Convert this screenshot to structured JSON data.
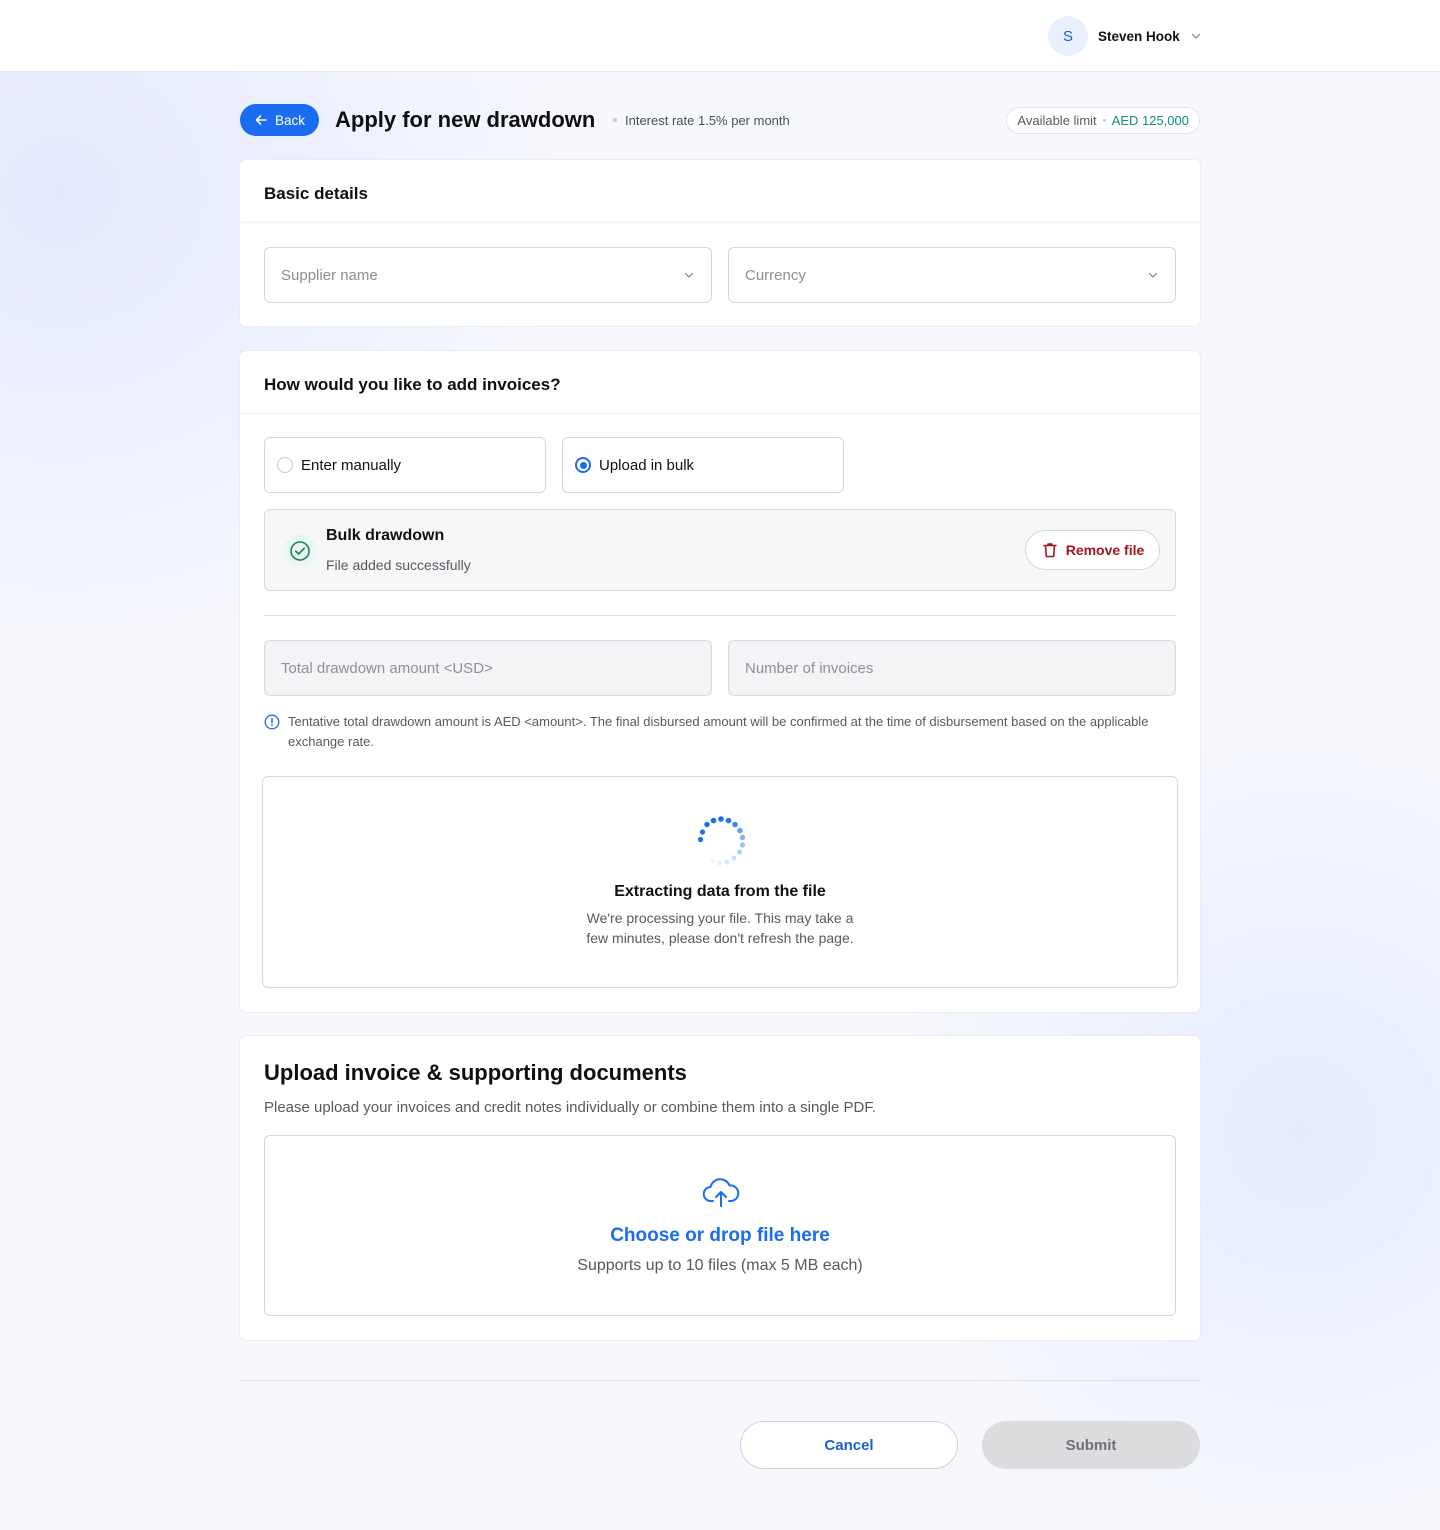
{
  "topbar": {
    "user": {
      "initial": "S",
      "name": "Steven Hook"
    }
  },
  "header": {
    "back_label": "Back",
    "title": "Apply for new drawdown",
    "interest": "Interest rate 1.5% per month",
    "limit_label": "Available limit",
    "limit_value": "AED 125,000"
  },
  "basic_details": {
    "title": "Basic details",
    "supplier_placeholder": "Supplier name",
    "currency_placeholder": "Currency"
  },
  "invoices": {
    "title": "How would you like to add invoices?",
    "options": [
      {
        "label": "Enter manually",
        "selected": false
      },
      {
        "label": "Upload in bulk",
        "selected": true
      }
    ],
    "file": {
      "title": "Bulk drawdown",
      "status": "File added successfully",
      "remove_label": "Remove file"
    },
    "total_placeholder": "Total drawdown amount <USD>",
    "count_placeholder": "Number of invoices",
    "note": "Tentative total drawdown amount is AED <amount>. The final disbursed amount will be confirmed at the time of disbursement based on the applicable exchange rate.",
    "extract": {
      "title": "Extracting data from the file",
      "line1": "We're processing your file. This may take a",
      "line2": "few minutes, please don't refresh the page."
    }
  },
  "upload": {
    "title": "Upload invoice & supporting documents",
    "description": "Please upload your invoices and credit notes individually or combine them into a single PDF.",
    "drop_title": "Choose or drop file here",
    "drop_sub": "Supports up to 10 files (max 5 MB each)"
  },
  "footer": {
    "cancel_label": "Cancel",
    "submit_label": "Submit"
  },
  "colors": {
    "primary": "#1a6cf0",
    "success": "#0f8e7a",
    "danger": "#a3161c"
  },
  "icons": [
    "arrow-left-icon",
    "chevron-down-icon",
    "check-circle-icon",
    "trash-icon",
    "info-icon",
    "spinner-icon",
    "cloud-upload-icon"
  ]
}
